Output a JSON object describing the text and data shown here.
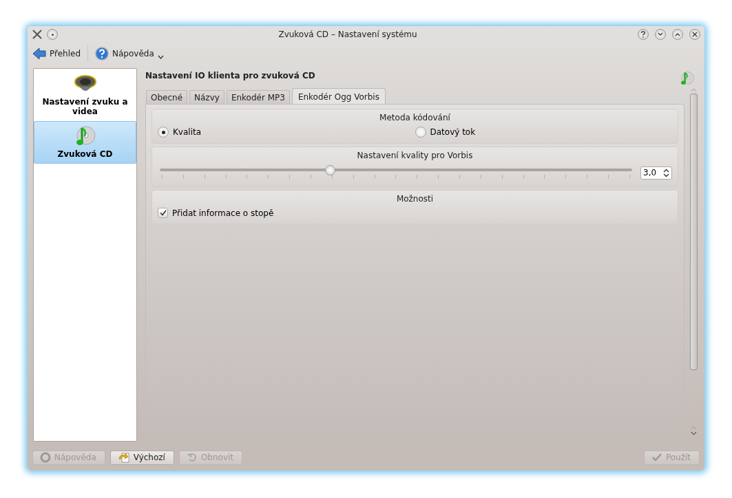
{
  "window": {
    "title": "Zvuková CD – Nastavení systému"
  },
  "toolbar": [
    {
      "label": "Přehled",
      "kind": "back"
    },
    {
      "label": "Nápověda",
      "kind": "help-menu"
    }
  ],
  "sidebar": {
    "items": [
      {
        "label": "Nastavení zvuku a videa",
        "kind": "speaker",
        "selected": false
      },
      {
        "label": "Zvuková CD",
        "kind": "cd",
        "selected": true
      }
    ]
  },
  "page": {
    "title": "Nastavení IO klienta pro zvuková CD"
  },
  "tabs": [
    {
      "label": "Obecné",
      "selected": false
    },
    {
      "label": "Názvy",
      "selected": false
    },
    {
      "label": "Enkodér MP3",
      "selected": false
    },
    {
      "label": "Enkodér Ogg Vorbis",
      "selected": true
    }
  ],
  "encoding_method": {
    "title": "Metoda kódování",
    "options": [
      {
        "label": "Kvalita",
        "selected": true
      },
      {
        "label": "Datový tok",
        "selected": false
      }
    ]
  },
  "quality": {
    "title": "Nastavení kvality pro Vorbis",
    "level": 0.36,
    "value": "3,0"
  },
  "options": {
    "title": "Možnosti",
    "checkboxes": [
      {
        "label": "Přidat informace o stopě",
        "checked": true
      }
    ]
  },
  "buttons": [
    {
      "label": "Nápověda",
      "kind": "help",
      "disabled": true
    },
    {
      "label": "Výchozí",
      "kind": "defaults",
      "disabled": false
    },
    {
      "label": "Obnovit",
      "kind": "reset",
      "disabled": true
    },
    {
      "label": "Použít",
      "kind": "apply",
      "disabled": true
    }
  ]
}
